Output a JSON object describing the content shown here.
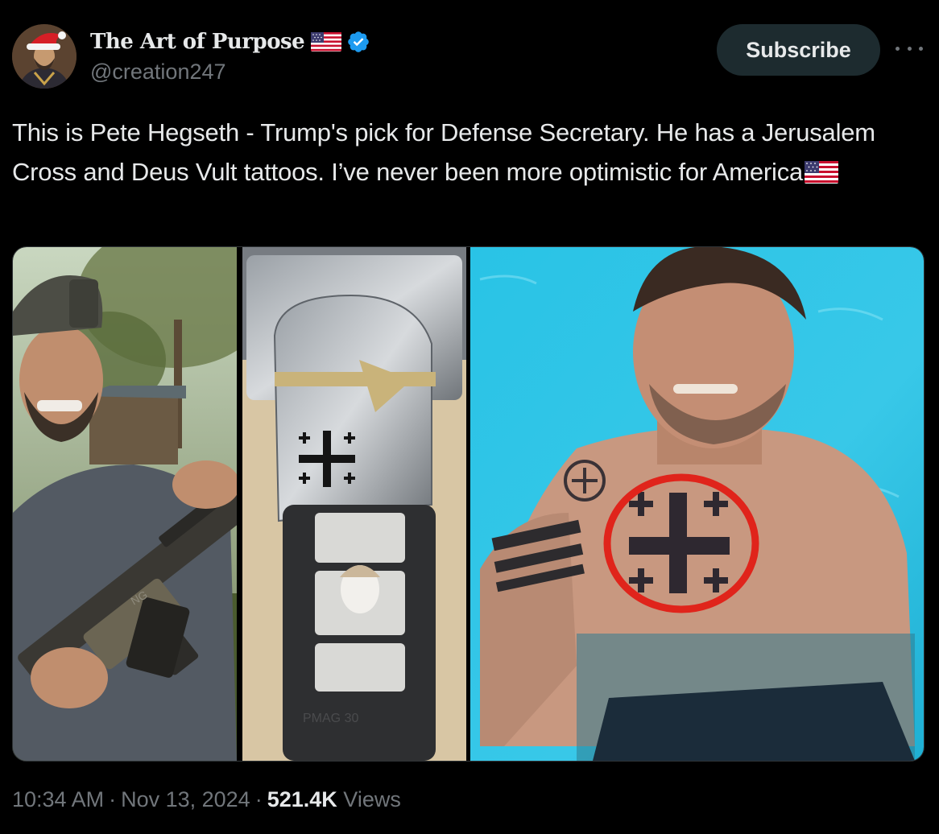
{
  "author": {
    "display_name": "The Art of Purpose",
    "handle": "@creation247",
    "flag_icon": "us-flag-icon",
    "verified_icon": "verified-badge-icon",
    "verified_color": "#1d9bf0"
  },
  "actions": {
    "subscribe_label": "Subscribe",
    "more_icon": "more-options-icon"
  },
  "tweet": {
    "text": "This is Pete Hegseth - Trump's pick for Defense Secretary. He has a Jerusalem Cross and Deus Vult tattoos. I’ve never been more optimistic for America",
    "trailing_emoji": "us-flag-icon"
  },
  "media": {
    "panels": 3,
    "panel_2_watermark": "PMAG 30"
  },
  "meta": {
    "time": "10:34 AM",
    "date": "Nov 13, 2024",
    "views_count": "521.4K",
    "views_label": "Views",
    "separator": "·"
  },
  "colors": {
    "background": "#000000",
    "text_primary": "#e7e9ea",
    "text_secondary": "#71767b",
    "subscribe_bg": "#1d2b2f",
    "highlight_circle": "#e0241b"
  }
}
